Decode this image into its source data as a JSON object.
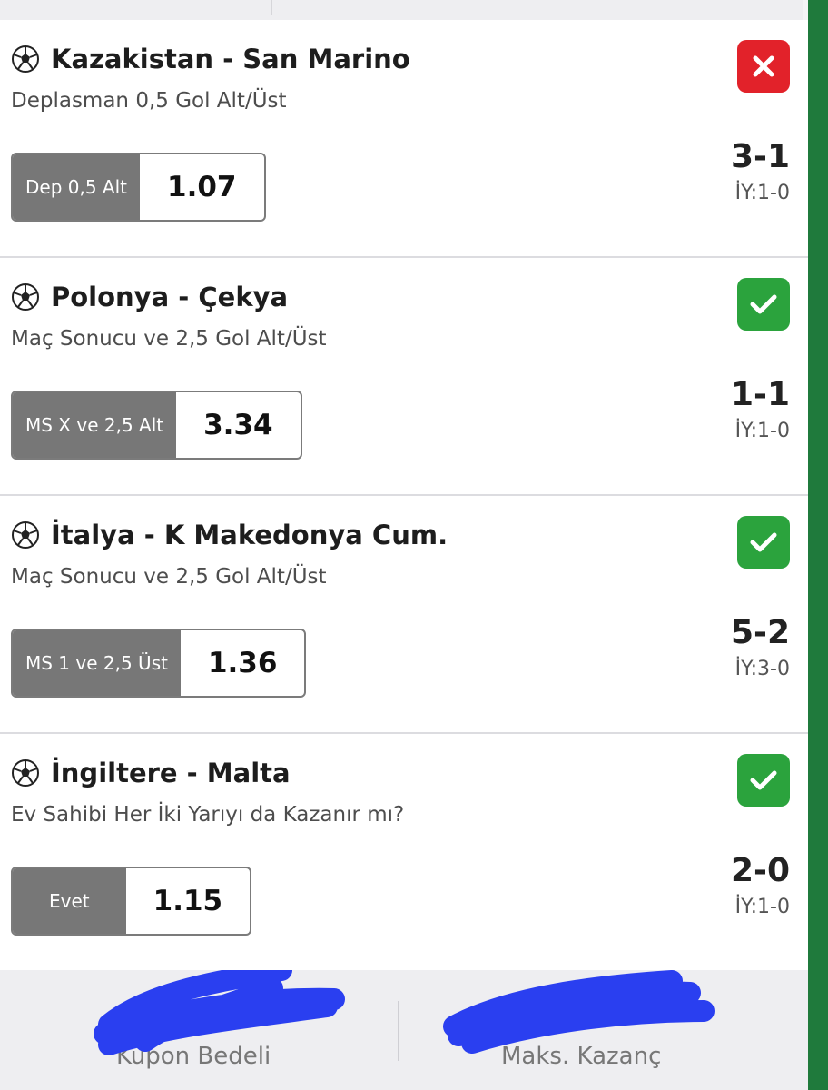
{
  "bets": [
    {
      "match": "Kazakistan - San Marino",
      "market": "Deplasman 0,5 Gol Alt/Üst",
      "pick": "Dep 0,5 Alt",
      "odd": "1.07",
      "score": "3-1",
      "halftime": "İY:1-0",
      "status": "lost"
    },
    {
      "match": "Polonya - Çekya",
      "market": "Maç Sonucu ve 2,5 Gol Alt/Üst",
      "pick": "MS X ve 2,5 Alt",
      "odd": "3.34",
      "score": "1-1",
      "halftime": "İY:1-0",
      "status": "won"
    },
    {
      "match": "İtalya - K Makedonya Cum.",
      "market": "Maç Sonucu ve 2,5 Gol Alt/Üst",
      "pick": "MS 1 ve 2,5 Üst",
      "odd": "1.36",
      "score": "5-2",
      "halftime": "İY:3-0",
      "status": "won"
    },
    {
      "match": "İngiltere - Malta",
      "market": "Ev Sahibi Her İki Yarıyı da Kazanır mı?",
      "pick": "Evet",
      "odd": "1.15",
      "score": "2-0",
      "halftime": "İY:1-0",
      "status": "won"
    }
  ],
  "footer": {
    "stake_label": "Kupon Bedeli",
    "max_win_label": "Maks. Kazanç"
  },
  "icons": {
    "sport": "soccer-ball-icon",
    "lost": "x-icon",
    "won": "check-icon"
  },
  "colors": {
    "lost": "#e2222a",
    "won": "#2ba33d",
    "pick_label_bg": "#777777",
    "accent_bar": "#1f7a3c",
    "redaction": "#2a3ff0"
  }
}
